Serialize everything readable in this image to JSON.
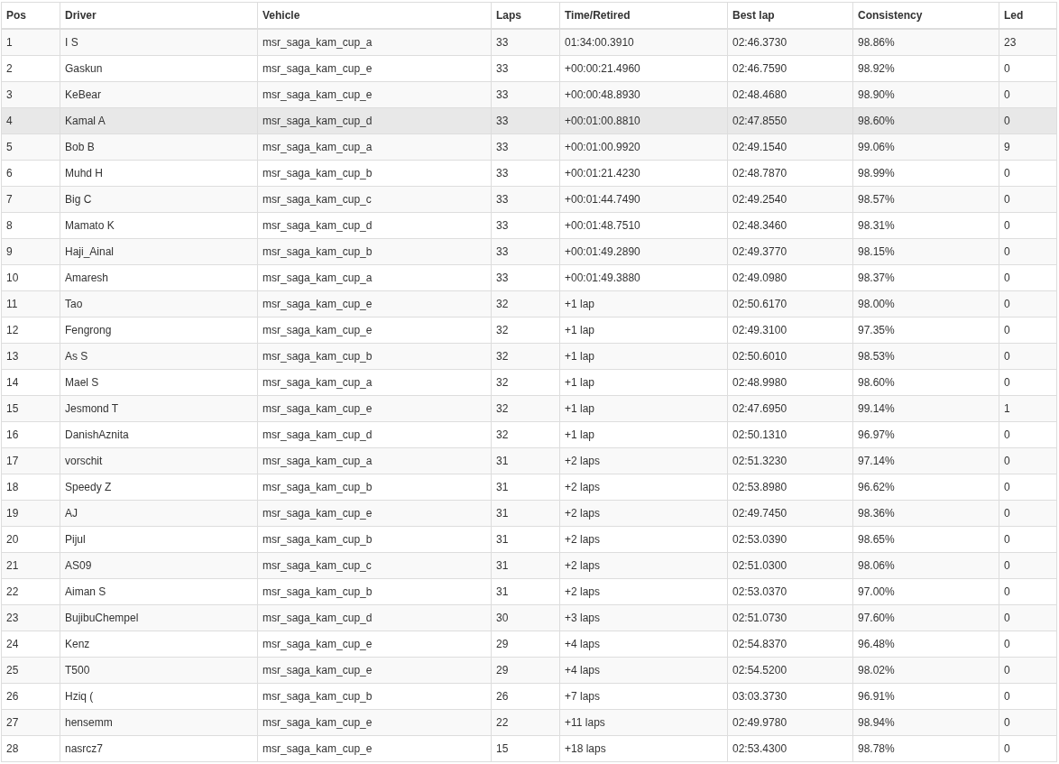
{
  "table": {
    "columns": [
      "Pos",
      "Driver",
      "Vehicle",
      "Laps",
      "Time/Retired",
      "Best lap",
      "Consistency",
      "Led"
    ],
    "rows": [
      {
        "hovered": false,
        "cells": [
          "1",
          "I S",
          "msr_saga_kam_cup_a",
          "33",
          "01:34:00.3910",
          "02:46.3730",
          "98.86%",
          "23"
        ]
      },
      {
        "hovered": false,
        "cells": [
          "2",
          "Gaskun",
          "msr_saga_kam_cup_e",
          "33",
          "+00:00:21.4960",
          "02:46.7590",
          "98.92%",
          "0"
        ]
      },
      {
        "hovered": false,
        "cells": [
          "3",
          "KeBear",
          "msr_saga_kam_cup_e",
          "33",
          "+00:00:48.8930",
          "02:48.4680",
          "98.90%",
          "0"
        ]
      },
      {
        "hovered": true,
        "cells": [
          "4",
          "Kamal A",
          "msr_saga_kam_cup_d",
          "33",
          "+00:01:00.8810",
          "02:47.8550",
          "98.60%",
          "0"
        ]
      },
      {
        "hovered": false,
        "cells": [
          "5",
          "Bob B",
          "msr_saga_kam_cup_a",
          "33",
          "+00:01:00.9920",
          "02:49.1540",
          "99.06%",
          "9"
        ]
      },
      {
        "hovered": false,
        "cells": [
          "6",
          "Muhd H",
          "msr_saga_kam_cup_b",
          "33",
          "+00:01:21.4230",
          "02:48.7870",
          "98.99%",
          "0"
        ]
      },
      {
        "hovered": false,
        "cells": [
          "7",
          "Big C",
          "msr_saga_kam_cup_c",
          "33",
          "+00:01:44.7490",
          "02:49.2540",
          "98.57%",
          "0"
        ]
      },
      {
        "hovered": false,
        "cells": [
          "8",
          "Mamato K",
          "msr_saga_kam_cup_d",
          "33",
          "+00:01:48.7510",
          "02:48.3460",
          "98.31%",
          "0"
        ]
      },
      {
        "hovered": false,
        "cells": [
          "9",
          "Haji_Ainal",
          "msr_saga_kam_cup_b",
          "33",
          "+00:01:49.2890",
          "02:49.3770",
          "98.15%",
          "0"
        ]
      },
      {
        "hovered": false,
        "cells": [
          "10",
          "Amaresh",
          "msr_saga_kam_cup_a",
          "33",
          "+00:01:49.3880",
          "02:49.0980",
          "98.37%",
          "0"
        ]
      },
      {
        "hovered": false,
        "cells": [
          "11",
          "Tao",
          "msr_saga_kam_cup_e",
          "32",
          "+1 lap",
          "02:50.6170",
          "98.00%",
          "0"
        ]
      },
      {
        "hovered": false,
        "cells": [
          "12",
          "Fengrong",
          "msr_saga_kam_cup_e",
          "32",
          "+1 lap",
          "02:49.3100",
          "97.35%",
          "0"
        ]
      },
      {
        "hovered": false,
        "cells": [
          "13",
          "As S",
          "msr_saga_kam_cup_b",
          "32",
          "+1 lap",
          "02:50.6010",
          "98.53%",
          "0"
        ]
      },
      {
        "hovered": false,
        "cells": [
          "14",
          "Mael S",
          "msr_saga_kam_cup_a",
          "32",
          "+1 lap",
          "02:48.9980",
          "98.60%",
          "0"
        ]
      },
      {
        "hovered": false,
        "cells": [
          "15",
          "Jesmond T",
          "msr_saga_kam_cup_e",
          "32",
          "+1 lap",
          "02:47.6950",
          "99.14%",
          "1"
        ]
      },
      {
        "hovered": false,
        "cells": [
          "16",
          "DanishAznita",
          "msr_saga_kam_cup_d",
          "32",
          "+1 lap",
          "02:50.1310",
          "96.97%",
          "0"
        ]
      },
      {
        "hovered": false,
        "cells": [
          "17",
          "vorschit",
          "msr_saga_kam_cup_a",
          "31",
          "+2 laps",
          "02:51.3230",
          "97.14%",
          "0"
        ]
      },
      {
        "hovered": false,
        "cells": [
          "18",
          "Speedy Z",
          "msr_saga_kam_cup_b",
          "31",
          "+2 laps",
          "02:53.8980",
          "96.62%",
          "0"
        ]
      },
      {
        "hovered": false,
        "cells": [
          "19",
          "AJ",
          "msr_saga_kam_cup_e",
          "31",
          "+2 laps",
          "02:49.7450",
          "98.36%",
          "0"
        ]
      },
      {
        "hovered": false,
        "cells": [
          "20",
          "Pijul",
          "msr_saga_kam_cup_b",
          "31",
          "+2 laps",
          "02:53.0390",
          "98.65%",
          "0"
        ]
      },
      {
        "hovered": false,
        "cells": [
          "21",
          "AS09",
          "msr_saga_kam_cup_c",
          "31",
          "+2 laps",
          "02:51.0300",
          "98.06%",
          "0"
        ]
      },
      {
        "hovered": false,
        "cells": [
          "22",
          "Aiman S",
          "msr_saga_kam_cup_b",
          "31",
          "+2 laps",
          "02:53.0370",
          "97.00%",
          "0"
        ]
      },
      {
        "hovered": false,
        "cells": [
          "23",
          "BujibuChempel",
          "msr_saga_kam_cup_d",
          "30",
          "+3 laps",
          "02:51.0730",
          "97.60%",
          "0"
        ]
      },
      {
        "hovered": false,
        "cells": [
          "24",
          "Kenz",
          "msr_saga_kam_cup_e",
          "29",
          "+4 laps",
          "02:54.8370",
          "96.48%",
          "0"
        ]
      },
      {
        "hovered": false,
        "cells": [
          "25",
          "T500",
          "msr_saga_kam_cup_e",
          "29",
          "+4 laps",
          "02:54.5200",
          "98.02%",
          "0"
        ]
      },
      {
        "hovered": false,
        "cells": [
          "26",
          "Hziq (",
          "msr_saga_kam_cup_b",
          "26",
          "+7 laps",
          "03:03.3730",
          "96.91%",
          "0"
        ]
      },
      {
        "hovered": false,
        "cells": [
          "27",
          "hensemm",
          "msr_saga_kam_cup_e",
          "22",
          "+11 laps",
          "02:49.9780",
          "98.94%",
          "0"
        ]
      },
      {
        "hovered": false,
        "cells": [
          "28",
          "nasrcz7",
          "msr_saga_kam_cup_e",
          "15",
          "+18 laps",
          "02:53.4300",
          "98.78%",
          "0"
        ]
      }
    ]
  }
}
